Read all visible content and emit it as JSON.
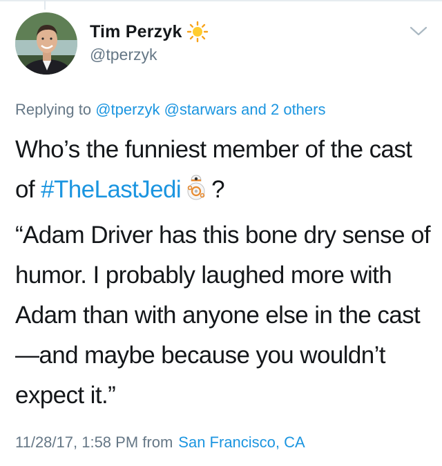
{
  "author": {
    "display_name": "Tim Perzyk",
    "handle": "@tperzyk",
    "badge_icon": "sun-emoji-icon",
    "avatar_icon": "avatar-photo"
  },
  "reply_context": {
    "prefix": "Replying to",
    "mention_1": "@tperzyk",
    "mention_2": "@starwars",
    "others": "and 2 others"
  },
  "tweet": {
    "line1_before": "Who’s the funniest member of the cast of ",
    "hashtag": "#TheLastJedi",
    "emoji_icon": "bb8-emoji-icon",
    "line1_after": "?",
    "quote": "“Adam Driver has this bone dry sense of humor. I probably laughed more with Adam than with anyone else in the cast—and maybe because you wouldn’t expect it.”"
  },
  "meta": {
    "timestamp": "11/28/17, 1:58 PM",
    "from_label": "from",
    "location": "San Francisco, CA"
  },
  "colors": {
    "link": "#1b95e0",
    "secondary_text": "#657786",
    "primary_text": "#14171a"
  }
}
